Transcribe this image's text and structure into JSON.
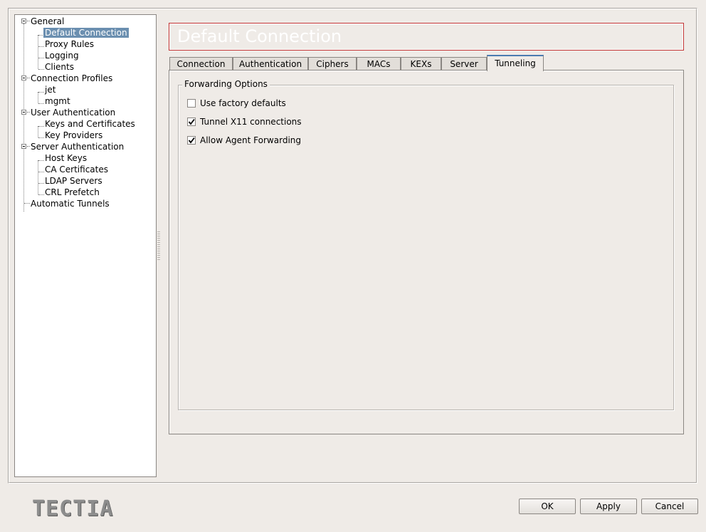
{
  "tree": {
    "general": "General",
    "default_connection": "Default Connection",
    "proxy_rules": "Proxy Rules",
    "logging": "Logging",
    "clients": "Clients",
    "connection_profiles": "Connection Profiles",
    "jet": "jet",
    "mgmt": "mgmt",
    "user_authentication": "User Authentication",
    "keys_and_certificates": "Keys and Certificates",
    "key_providers": "Key Providers",
    "server_authentication": "Server Authentication",
    "host_keys": "Host Keys",
    "ca_certificates": "CA Certificates",
    "ldap_servers": "LDAP Servers",
    "crl_prefetch": "CRL Prefetch",
    "automatic_tunnels": "Automatic Tunnels",
    "selected": "Default Connection"
  },
  "title": "Default Connection",
  "tabs": [
    "Connection",
    "Authentication",
    "Ciphers",
    "MACs",
    "KEXs",
    "Server",
    "Tunneling"
  ],
  "active_tab": "Tunneling",
  "forwarding": {
    "group_title": "Forwarding Options",
    "use_factory_defaults": {
      "label": "Use factory defaults",
      "checked": false
    },
    "tunnel_x11": {
      "label": "Tunnel X11 connections",
      "checked": true
    },
    "agent_forwarding": {
      "label": "Allow Agent Forwarding",
      "checked": true
    }
  },
  "logo": "TECTIA",
  "buttons": {
    "ok": "OK",
    "apply": "Apply",
    "cancel": "Cancel"
  },
  "colors": {
    "selection": "#6b8fb0",
    "title_border": "#c23434",
    "background": "#efebe7"
  }
}
